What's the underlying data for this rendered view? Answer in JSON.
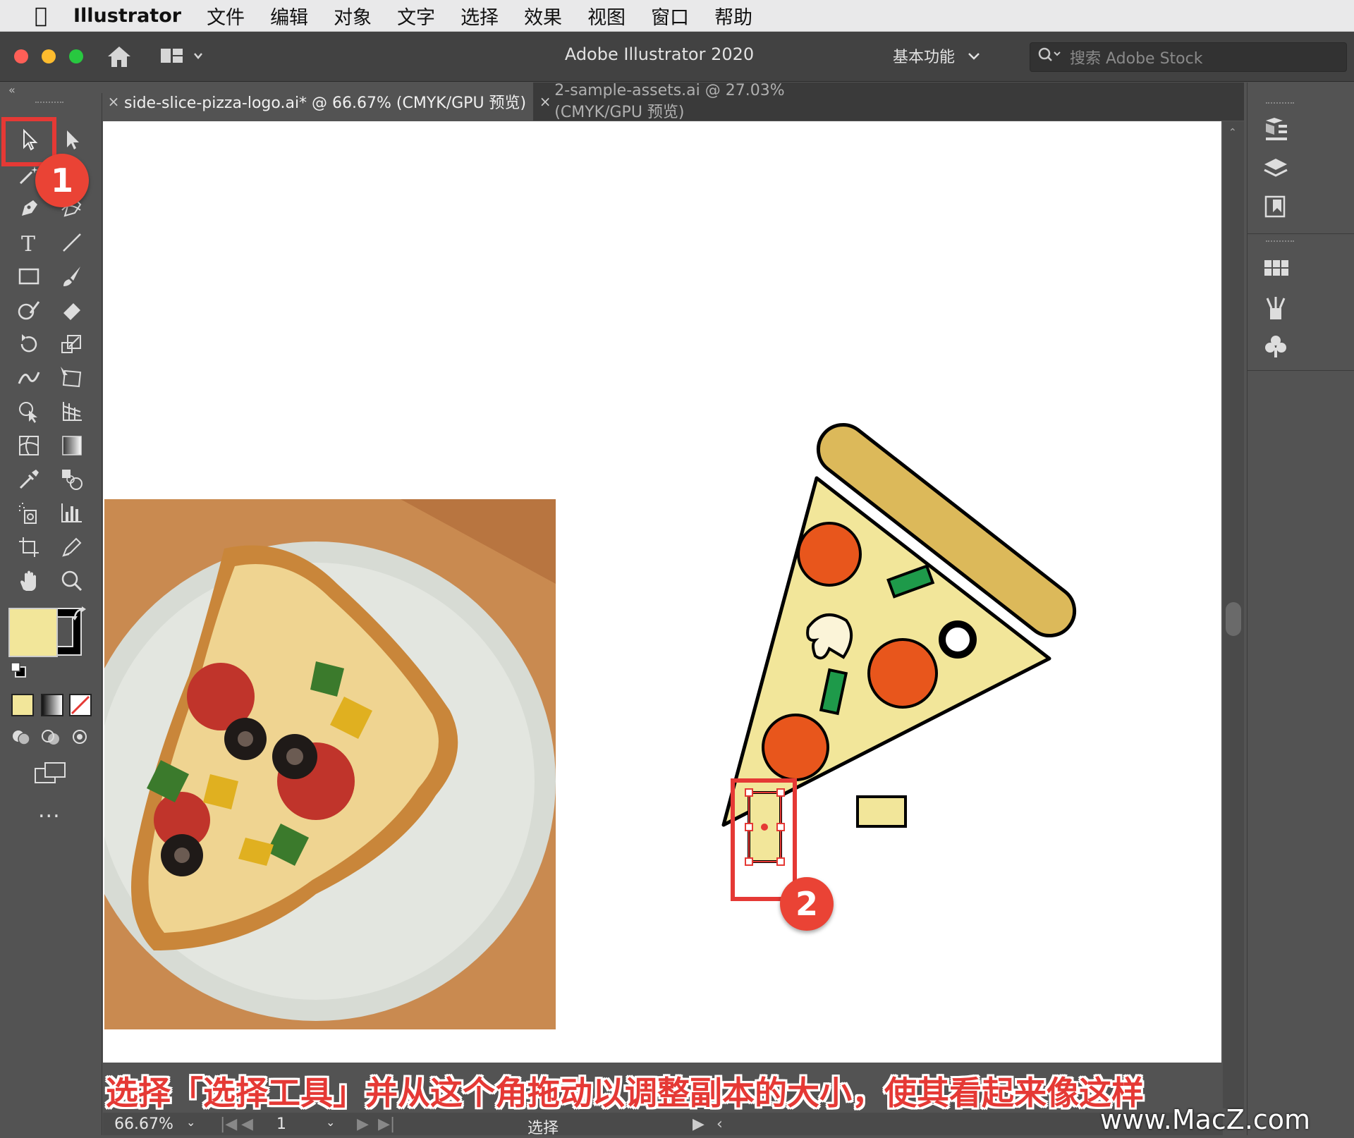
{
  "menubar": {
    "app": "Illustrator",
    "items": [
      "文件",
      "编辑",
      "对象",
      "文字",
      "选择",
      "效果",
      "视图",
      "窗口",
      "帮助"
    ]
  },
  "appbar": {
    "title": "Adobe Illustrator 2020",
    "workspace": "基本功能",
    "search_placeholder": "搜索 Adobe Stock"
  },
  "tabs": [
    {
      "label": "side-slice-pizza-logo.ai* @ 66.67% (CMYK/GPU 预览)",
      "active": true
    },
    {
      "label": "2-sample-assets.ai @ 27.03% (CMYK/GPU 预览)",
      "active": false
    }
  ],
  "toolbar": {
    "tools": [
      "selection-tool",
      "direct-selection-tool",
      "magic-wand-tool",
      "lasso-tool",
      "pen-tool",
      "curvature-tool",
      "type-tool",
      "line-segment-tool",
      "rectangle-tool",
      "paintbrush-tool",
      "shaper-tool",
      "eraser-tool",
      "rotate-tool",
      "scale-tool",
      "width-tool",
      "free-transform-tool",
      "shape-builder-tool",
      "perspective-grid-tool",
      "mesh-tool",
      "gradient-tool",
      "eyedropper-tool",
      "blend-tool",
      "symbol-sprayer-tool",
      "column-graph-tool",
      "artboard-tool",
      "slice-tool",
      "hand-tool",
      "zoom-tool"
    ],
    "fill_color": "#f2e69a",
    "stroke_color": "#000000",
    "more": "..."
  },
  "artwork": {
    "pizza_colors": {
      "crust": "#dcb95a",
      "cheese": "#f2e69a",
      "pepperoni": "#e8561c",
      "pepper": "#1e9a4a",
      "mushroom": "#fbf4d8"
    }
  },
  "annotations": {
    "badge1": "1",
    "badge2": "2",
    "accent": "#e53935"
  },
  "caption": "选择「选择工具」并从这个角拖动以调整副本的大小，使其看起来像这样",
  "watermark": "www.MacZ.com",
  "statusbar": {
    "zoom": "66.67%",
    "artboard": "1",
    "tool": "选择"
  }
}
